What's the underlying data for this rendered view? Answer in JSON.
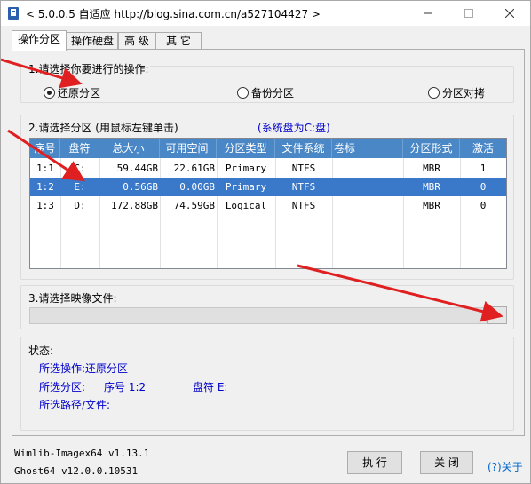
{
  "window": {
    "title": "< 5.0.0.5 自适应 http://blog.sina.com.cn/a527104427 >",
    "controls": {
      "minimize": "─",
      "maximize": "☐",
      "close": "✕"
    }
  },
  "tabs": [
    {
      "label": "操作分区",
      "active": true
    },
    {
      "label": "操作硬盘",
      "active": false
    },
    {
      "label": "高 级",
      "active": false
    },
    {
      "label": "其 它",
      "active": false
    }
  ],
  "operation": {
    "label": "1.请选择你要进行的操作:",
    "options": [
      {
        "label": "还原分区",
        "selected": true
      },
      {
        "label": "备份分区",
        "selected": false
      },
      {
        "label": "分区对拷",
        "selected": false
      }
    ]
  },
  "partition": {
    "label": "2.请选择分区 (用鼠标左键单击)",
    "system_disk": "(系统盘为C:盘)",
    "columns": [
      "序号",
      "盘符",
      "总大小",
      "可用空间",
      "分区类型",
      "文件系统",
      "卷标",
      "分区形式",
      "激活"
    ],
    "rows": [
      {
        "index": "1:1",
        "drive": "C:",
        "total": "59.44GB",
        "free": "22.61GB",
        "type": "Primary",
        "fs": "NTFS",
        "volume": "",
        "style": "MBR",
        "active": "1",
        "selected": false
      },
      {
        "index": "1:2",
        "drive": "E:",
        "total": "0.56GB",
        "free": "0.00GB",
        "type": "Primary",
        "fs": "NTFS",
        "volume": "",
        "style": "MBR",
        "active": "0",
        "selected": true
      },
      {
        "index": "1:3",
        "drive": "D:",
        "total": "172.88GB",
        "free": "74.59GB",
        "type": "Logical",
        "fs": "NTFS",
        "volume": "",
        "style": "MBR",
        "active": "0",
        "selected": false
      }
    ]
  },
  "image_file": {
    "label": "3.请选择映像文件:",
    "value": ""
  },
  "status": {
    "label": "状态:",
    "operation_label": "所选操作:",
    "operation_value": "还原分区",
    "partition_label": "所选分区:",
    "partition_index_label": "序号",
    "partition_index": "1:2",
    "partition_drive_label": "盘符",
    "partition_drive": "E:",
    "path_label": "所选路径/文件:"
  },
  "footer": {
    "wimlib": "Wimlib-Imagex64 v1.13.1",
    "ghost": "Ghost64 v12.0.0.10531",
    "execute": "执 行",
    "close": "关 闭",
    "about": "(?)关于"
  },
  "colors": {
    "header_bg": "#4a87c6",
    "selection_bg": "#3a78c9",
    "status_text": "#0000cc",
    "arrow": "#e02020"
  }
}
